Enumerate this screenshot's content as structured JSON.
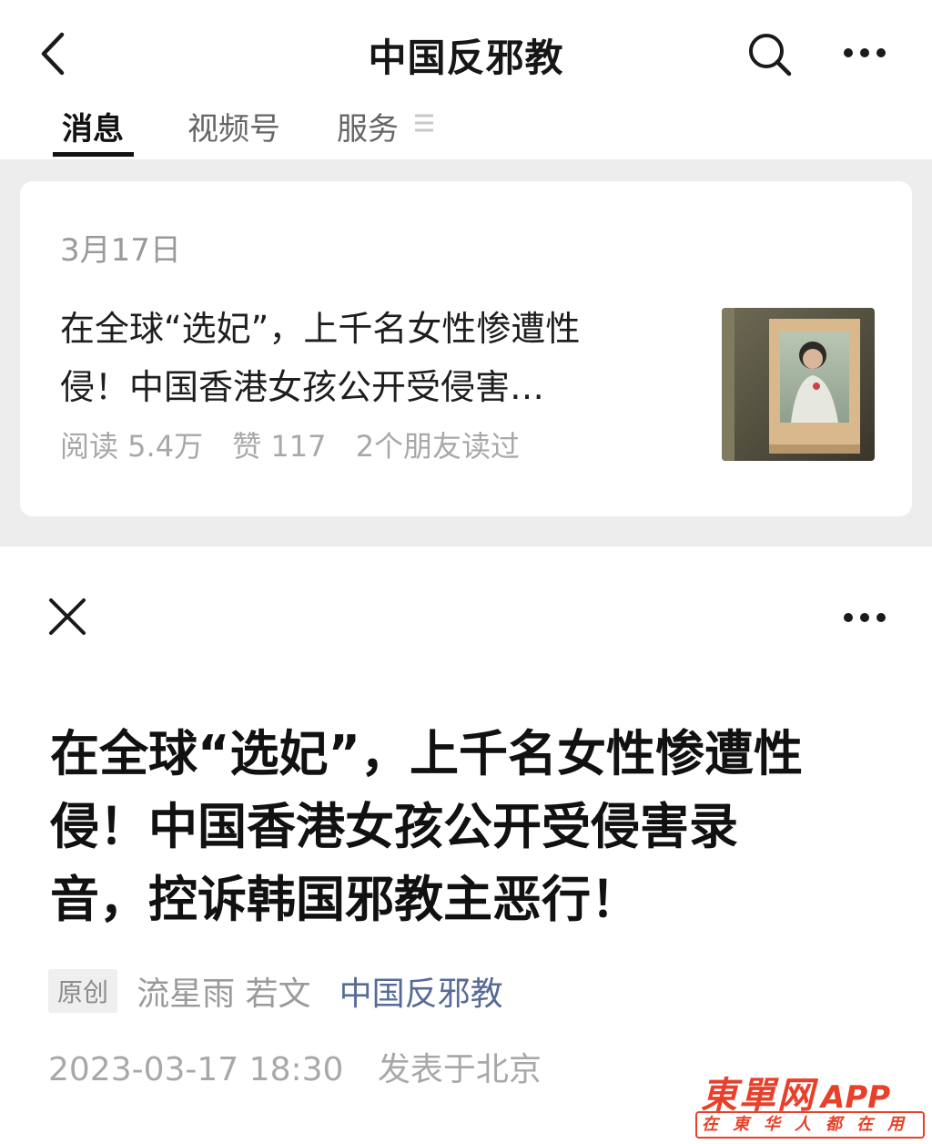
{
  "header": {
    "title": "中国反邪教",
    "back_icon": "chevron-left-icon",
    "search_icon": "search-icon",
    "more_icon": "more-dots-icon"
  },
  "tabs": [
    {
      "label": "消息",
      "active": true
    },
    {
      "label": "视频号",
      "active": false
    },
    {
      "label": "服务",
      "active": false
    }
  ],
  "tab_menu_icon": "menu-lines-icon",
  "card": {
    "date": "3月17日",
    "title_lines": [
      "在全球“选妃”，上千名女性惨遭性",
      "侵！中国香港女孩公开受侵害…"
    ],
    "reads": "阅读 5.4万",
    "likes": "赞 117",
    "friends": "2个朋友读过",
    "thumbnail": "framed-photo-thumbnail"
  },
  "article": {
    "close_icon": "close-icon",
    "more_icon": "more-dots-icon",
    "title_lines": [
      "在全球“选妃”，上千名女性惨遭性",
      "侵！中国香港女孩公开受侵害录",
      "音，控诉韩国邪教主恶行！"
    ],
    "original_badge": "原创",
    "authors": "流星雨 若文",
    "account": "中国反邪教",
    "datetime": "2023-03-17 18:30",
    "location": "发表于北京"
  },
  "watermark": {
    "brand": "東單网",
    "app": "APP",
    "slogan": "在東华人都在用"
  },
  "colors": {
    "link": "#576b95",
    "grey_bg": "#ededed",
    "watermark": "#e8402a"
  }
}
